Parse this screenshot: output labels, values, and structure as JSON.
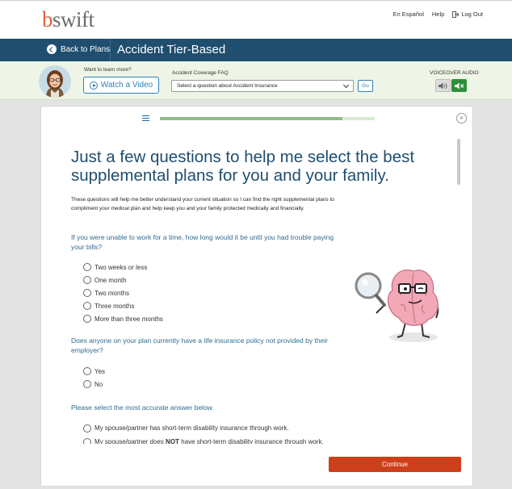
{
  "brand": {
    "logo_b": "b",
    "logo_rest": "swift"
  },
  "top_links": {
    "spanish": "En Español",
    "help": "Help",
    "logout": "Log Out"
  },
  "nav": {
    "back_label": "Back to Plans",
    "title": "Accident Tier-Based"
  },
  "help_bar": {
    "learn_label": "Want to learn more?",
    "video_label": "Watch a Video",
    "faq_label": "Accident Coverage FAQ",
    "faq_select_value": "Select a question about Accident Insurance",
    "go_label": "Go",
    "voiceover_label": "VOICEOVER AUDIO"
  },
  "progress": {
    "fraction": 0.85
  },
  "main": {
    "heading": "Just a few questions to help me select the best supplemental plans for you and your family.",
    "intro": "These questions will help me better understand your current situation so I can find the right supplemental plans to compliment your medical plan and help keep you and your family protected medically and financially."
  },
  "questions": [
    {
      "text": "If you were unable to work for a time, how long would it be until you had trouble paying your bills?",
      "options": [
        "Two weeks or less",
        "One month",
        "Two months",
        "Three months",
        "More than three months"
      ]
    },
    {
      "text": "Does anyone on your plan currently have a life insurance policy not provided by their employer?",
      "options": [
        "Yes",
        "No"
      ]
    },
    {
      "text": "Please select the most accurate answer below.",
      "options": [
        {
          "pre": "My spouse/partner has short-term disability insurance through work.",
          "bold": "",
          "post": ""
        },
        {
          "pre": "My spouse/partner does ",
          "bold": "NOT",
          "post": " have short-term disability insurance through work."
        }
      ]
    }
  ],
  "footer": {
    "continue_label": "Continue"
  },
  "colors": {
    "navy": "#1f4e6f",
    "accent_blue": "#2e82b3",
    "continue": "#cc3f1b",
    "progress": "#8cc084",
    "voice_on": "#2d8f3c"
  }
}
